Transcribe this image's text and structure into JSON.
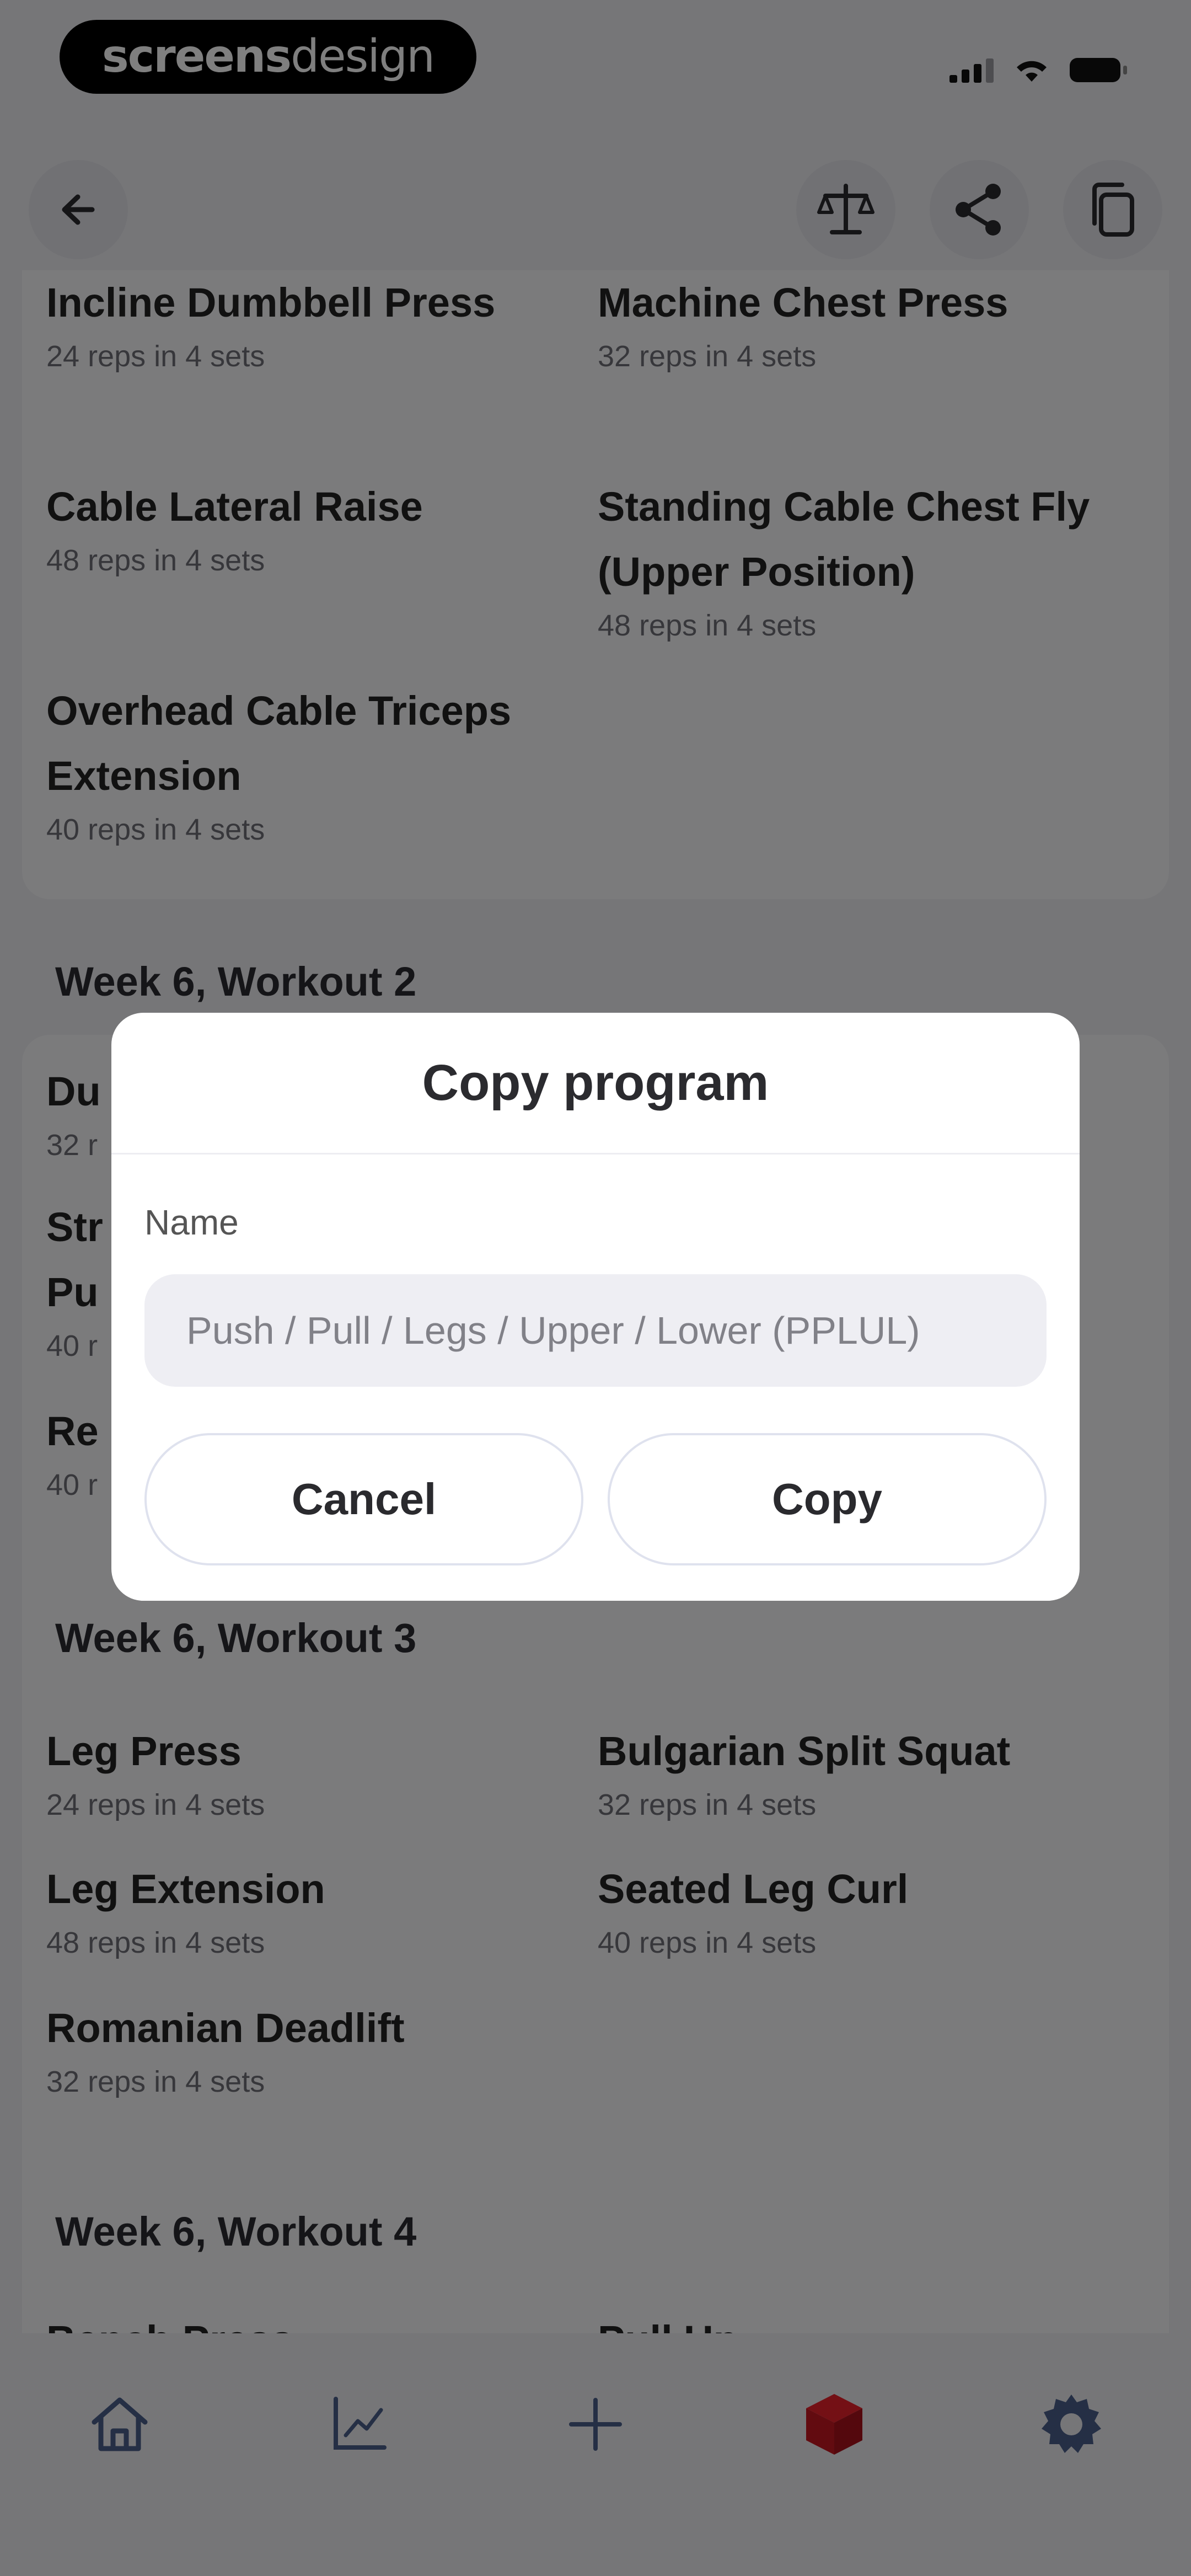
{
  "status_bar": {
    "brand_bold": "screens",
    "brand_light": "design"
  },
  "nav": {
    "back_icon": "arrow-left-icon",
    "actions": [
      "balance-scale-icon",
      "share-icon",
      "copy-icon"
    ]
  },
  "workouts": [
    {
      "title": "",
      "exercises": [
        {
          "name": "Incline Dumbbell Press",
          "detail": "24 reps in 4 sets"
        },
        {
          "name": "Machine Chest Press",
          "detail": "32 reps in 4 sets"
        },
        {
          "name": "Cable Lateral Raise",
          "detail": "48 reps in 4 sets"
        },
        {
          "name": "Standing Cable Chest Fly (Upper Position)",
          "detail": "48 reps in 4 sets"
        },
        {
          "name": "Overhead Cable Triceps Extension",
          "detail": "40 reps in 4 sets"
        }
      ]
    },
    {
      "title": "Week 6, Workout 2",
      "exercises": [
        {
          "name": "Du",
          "detail": "32 r"
        },
        {
          "name": "Str",
          "detail": ""
        },
        {
          "name": "Pu",
          "detail": "40 r"
        },
        {
          "name": "Re",
          "detail": "40 r"
        }
      ]
    },
    {
      "title": "Week 6, Workout 3",
      "exercises": [
        {
          "name": "Leg Press",
          "detail": "24 reps in 4 sets"
        },
        {
          "name": "Bulgarian Split Squat",
          "detail": "32 reps in 4 sets"
        },
        {
          "name": "Leg Extension",
          "detail": "48 reps in 4 sets"
        },
        {
          "name": "Seated Leg Curl",
          "detail": "40 reps in 4 sets"
        },
        {
          "name": "Romanian Deadlift",
          "detail": "32 reps in 4 sets"
        }
      ]
    },
    {
      "title": "Week 6, Workout 4",
      "exercises": [
        {
          "name": "Bench Press",
          "detail": ""
        },
        {
          "name": "Pull Up",
          "detail": ""
        }
      ]
    }
  ],
  "tab_bar": {
    "tabs": [
      "home-icon",
      "chart-icon",
      "plus-icon",
      "cube-icon",
      "gear-icon"
    ],
    "active_color": "#e8202a"
  },
  "dialog": {
    "title": "Copy program",
    "name_label": "Name",
    "name_placeholder": "Push / Pull / Legs / Upper / Lower (PPLUL)",
    "name_value": "",
    "cancel_label": "Cancel",
    "copy_label": "Copy"
  }
}
